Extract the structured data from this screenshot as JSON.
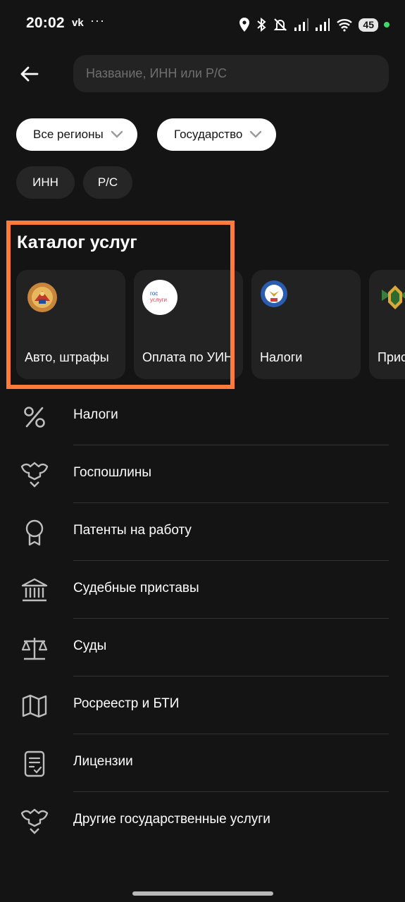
{
  "status_bar": {
    "time": "20:02",
    "vk": "vk",
    "dots": "···",
    "battery": "45"
  },
  "search": {
    "placeholder": "Название, ИНН или Р/С"
  },
  "filters": [
    {
      "label": "Все регионы"
    },
    {
      "label": "Государство"
    }
  ],
  "tags": [
    {
      "label": "ИНН"
    },
    {
      "label": "Р/С"
    }
  ],
  "catalog": {
    "title": "Каталог услуг",
    "cards": [
      {
        "label": "Авто, штрафы",
        "icon": "traffic-police-emblem-icon"
      },
      {
        "label": "Оплата по УИН",
        "icon": "gosuslugi-logo-icon",
        "logo_line1": "гос",
        "logo_line2": "услуги"
      },
      {
        "label": "Налоги",
        "icon": "tax-service-emblem-icon"
      },
      {
        "label": "Прис",
        "icon": "bailiffs-emblem-icon"
      }
    ]
  },
  "services": [
    {
      "label": "Налоги",
      "icon": "percent-icon"
    },
    {
      "label": "Госпошлины",
      "icon": "eagle-emblem-icon"
    },
    {
      "label": "Патенты на работу",
      "icon": "award-badge-icon"
    },
    {
      "label": "Судебные приставы",
      "icon": "courthouse-icon"
    },
    {
      "label": "Суды",
      "icon": "scales-icon"
    },
    {
      "label": "Росреестр и БТИ",
      "icon": "map-icon"
    },
    {
      "label": "Лицензии",
      "icon": "document-check-icon"
    },
    {
      "label": "Другие государственные услуги",
      "icon": "eagle-emblem-icon"
    }
  ],
  "colors": {
    "background": "#141414",
    "highlight": "#ff7a3d",
    "card": "#222222",
    "chip_white": "#ffffff"
  }
}
